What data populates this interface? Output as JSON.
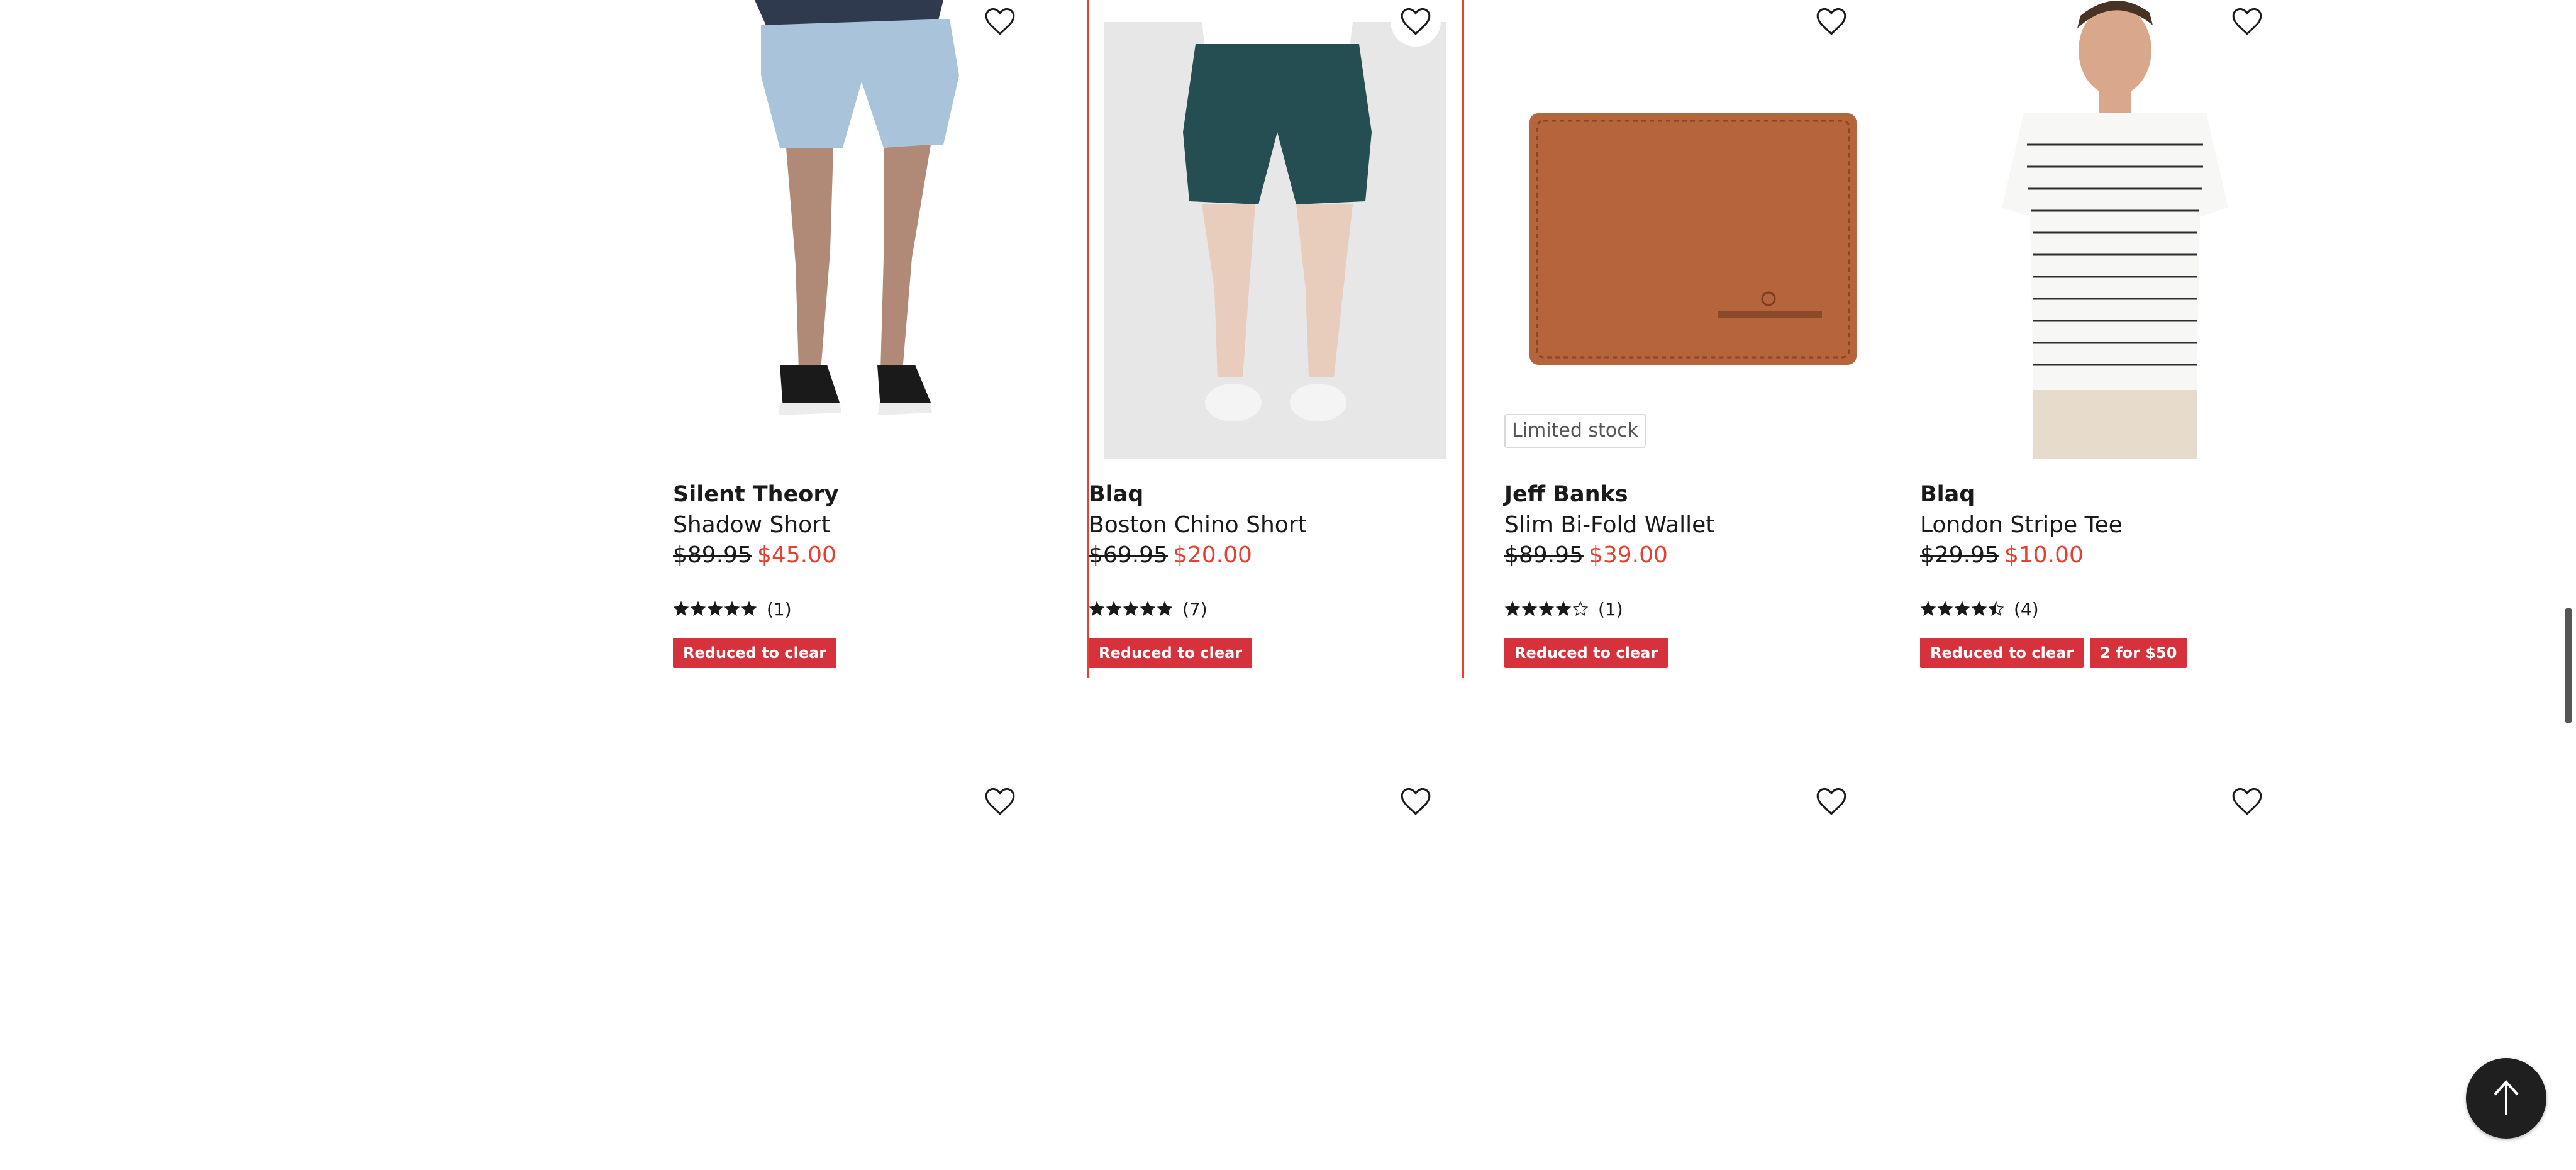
{
  "products": [
    {
      "brand": "Silent Theory",
      "name": "Shadow Short",
      "was_price": "$89.95",
      "now_price": "$45.00",
      "rating": 5,
      "review_count": "(1)",
      "tags": [
        "Reduced to clear"
      ],
      "badge": ""
    },
    {
      "brand": "Blaq",
      "name": "Boston Chino Short",
      "was_price": "$69.95",
      "now_price": "$20.00",
      "rating": 5,
      "review_count": "(7)",
      "tags": [
        "Reduced to clear"
      ],
      "badge": ""
    },
    {
      "brand": "Jeff Banks",
      "name": "Slim Bi-Fold Wallet",
      "was_price": "$89.95",
      "now_price": "$39.00",
      "rating": 4,
      "review_count": "(1)",
      "tags": [
        "Reduced to clear"
      ],
      "badge": "Limited stock"
    },
    {
      "brand": "Blaq",
      "name": "London Stripe Tee",
      "was_price": "$29.95",
      "now_price": "$10.00",
      "rating": 4.5,
      "review_count": "(4)",
      "tags": [
        "Reduced to clear",
        "2 for $50"
      ],
      "badge": ""
    }
  ],
  "colors": {
    "sale_price": "#e8402f",
    "tag_bg": "#d6323c",
    "highlight_border": "#e8402f",
    "back_to_top_bg": "#1f1f1f"
  },
  "icons": {
    "favorite": "heart-outline-icon",
    "back_to_top": "arrow-up-icon",
    "rating": "star-icon"
  }
}
